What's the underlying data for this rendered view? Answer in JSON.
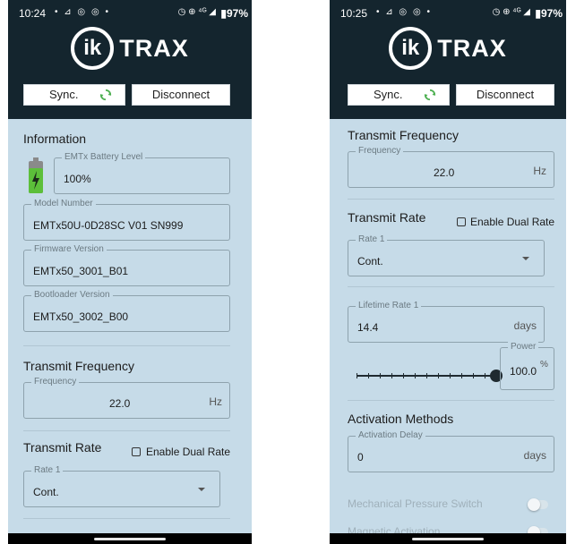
{
  "left": {
    "status": {
      "time": "10:24",
      "left_icons": "• ⊿ ◎ ◎ •",
      "right_icons": "◷ ⊕ ⁴ᴳ ◢",
      "battery": "▮97%"
    },
    "brand": {
      "mark": "ik",
      "name": "TRAX"
    },
    "buttons": {
      "sync": "Sync.",
      "disconnect": "Disconnect"
    },
    "information": {
      "title": "Information",
      "battery_label": "EMTx Battery Level",
      "battery_value": "100%",
      "battery_fill": 1.0,
      "model_label": "Model Number",
      "model_value": "EMTx50U-0D28SC V01 SN999",
      "firmware_label": "Firmware Version",
      "firmware_value": "EMTx50_3001_B01",
      "bootloader_label": "Bootloader Version",
      "bootloader_value": "EMTx50_3002_B00"
    },
    "transmit_frequency": {
      "title": "Transmit Frequency",
      "label": "Frequency",
      "value": "22.0",
      "unit": "Hz"
    },
    "transmit_rate": {
      "title": "Transmit Rate",
      "dual_rate_label": "Enable Dual Rate",
      "rate_label": "Rate 1",
      "rate_value": "Cont."
    }
  },
  "right": {
    "status": {
      "time": "10:25",
      "left_icons": "• ⊿ ◎ ◎ •",
      "right_icons": "◷ ⊕ ⁴ᴳ ◢",
      "battery": "▮97%"
    },
    "brand": {
      "mark": "ik",
      "name": "TRAX"
    },
    "buttons": {
      "sync": "Sync.",
      "disconnect": "Disconnect"
    },
    "transmit_frequency": {
      "title": "Transmit Frequency",
      "label": "Frequency",
      "value": "22.0",
      "unit": "Hz"
    },
    "transmit_rate": {
      "title": "Transmit Rate",
      "dual_rate_label": "Enable Dual Rate",
      "rate_label": "Rate 1",
      "rate_value": "Cont.",
      "lifetime_label": "Lifetime Rate 1",
      "lifetime_value": "14.4",
      "lifetime_unit": "days",
      "power_label": "Power",
      "power_value": "100.0",
      "power_unit": "%",
      "power_slider_fraction": 1.0
    },
    "activation": {
      "title": "Activation Methods",
      "delay_label": "Activation Delay",
      "delay_value": "0",
      "delay_unit": "days",
      "pressure_switch": "Mechanical Pressure Switch",
      "magnetic": "Magnetic Activation"
    }
  },
  "colors": {
    "header": "#14252e",
    "background": "#c6dbe8",
    "battery_green": "#5cbf3a",
    "slider": "#1f2a30"
  }
}
